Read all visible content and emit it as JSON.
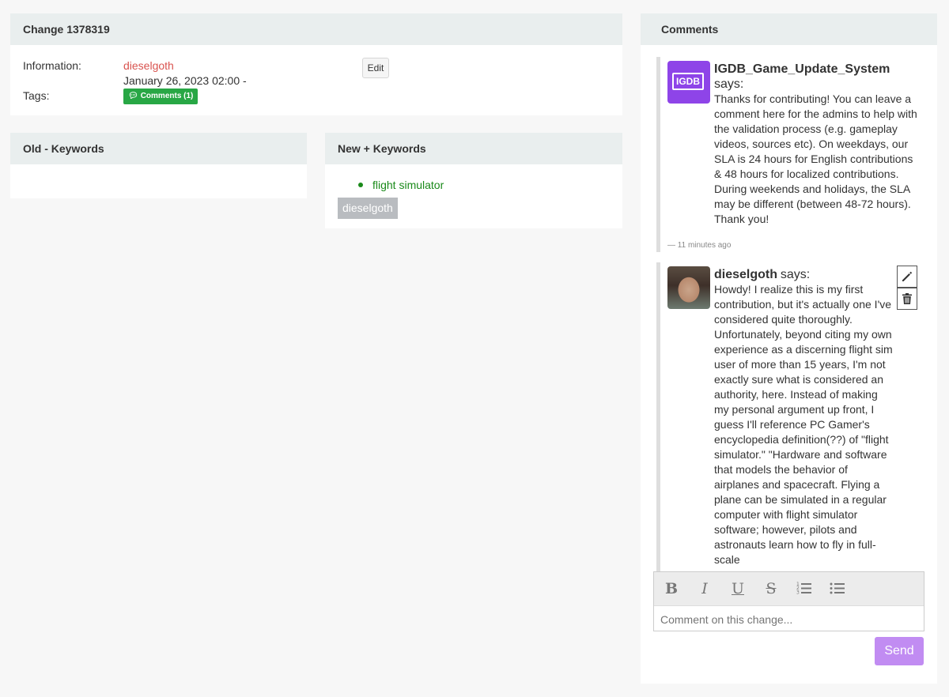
{
  "change": {
    "title": "Change 1378319",
    "information_label": "Information:",
    "user": "dieselgoth",
    "date": "January 26, 2023 02:00 -",
    "tags_label": "Tags:",
    "tag_badge": "Comments (1)",
    "edit_label": "Edit"
  },
  "old_keywords": {
    "title": "Old - Keywords"
  },
  "new_keywords": {
    "title": "New + Keywords",
    "items": [
      "flight simulator"
    ],
    "author": "dieselgoth"
  },
  "comments": {
    "title": "Comments",
    "list": [
      {
        "author": "IGDB_Game_Update_System",
        "says": "says:",
        "avatar": "IGDB",
        "text": "Thanks for contributing! You can leave a comment here for the admins to help with the validation process (e.g. gameplay videos, sources etc). On weekdays, our SLA is 24 hours for English contributions & 48 hours for localized contributions. During weekends and holidays, the SLA may be different (between 48-72 hours). Thank you!",
        "time": "— 11 minutes ago"
      },
      {
        "author": "dieselgoth",
        "says": "says:",
        "text": "Howdy! I realize this is my first contribution, but it's actually one I've considered quite thoroughly. Unfortunately, beyond citing my own experience as a discerning flight sim user of more than 15 years, I'm not exactly sure what is considered an authority, here. Instead of making my personal argument up front, I guess I'll reference PC Gamer's encyclopedia definition(??) of \"flight simulator.\" \"Hardware and software that models the behavior of airplanes and spacecraft. Flying a plane can be simulated in a regular computer with flight simulator software; however, pilots and astronauts learn how to fly in full-scale"
      }
    ],
    "placeholder": "Comment on this change...",
    "send_label": "Send",
    "toolbar": [
      "bold-icon",
      "italic-icon",
      "underline-icon",
      "strikethrough-icon",
      "ordered-list-icon",
      "unordered-list-icon"
    ]
  },
  "colors": {
    "user_link": "#d9534f",
    "tag_green": "#28a745",
    "keyword_green": "#1a8a1a",
    "igdb_purple": "#8e44e8",
    "send_purple": "#c18cf2"
  }
}
